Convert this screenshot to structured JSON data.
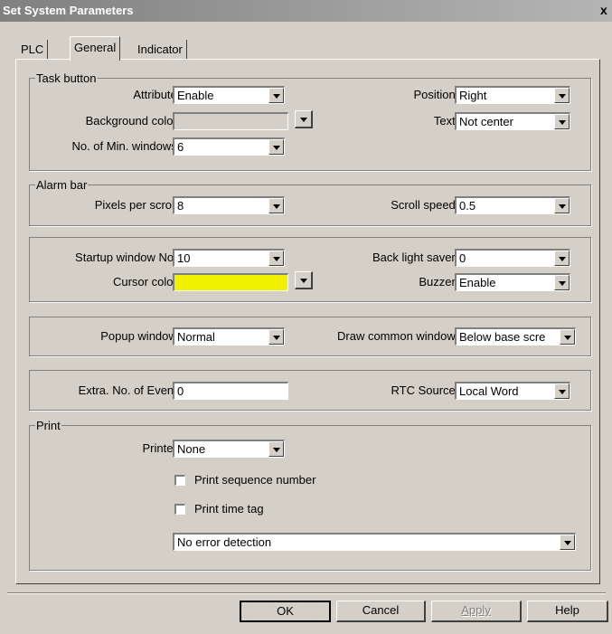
{
  "window": {
    "title": "Set System Parameters",
    "close_glyph": "x"
  },
  "tabs": [
    {
      "label": "PLC",
      "active": false
    },
    {
      "label": "General",
      "active": true
    },
    {
      "label": "Indicator",
      "active": false
    }
  ],
  "task_button": {
    "legend": "Task button",
    "attribute_label": "Attribute :",
    "attribute_value": "Enable",
    "position_label": "Position :",
    "position_value": "Right",
    "bg_color_label": "Background color :",
    "text_label": "Text :",
    "text_value": "Not center",
    "min_windows_label": "No. of Min. windows :",
    "min_windows_value": "6"
  },
  "alarm_bar": {
    "legend": "Alarm bar",
    "pixels_label": "Pixels per scroll :",
    "pixels_value": "8",
    "speed_label": "Scroll speed :",
    "speed_value": "0.5"
  },
  "startup": {
    "window_label": "Startup window No. :",
    "window_value": "10",
    "backlight_label": "Back light saver :",
    "backlight_value": "0",
    "cursor_label": "Cursor color :",
    "cursor_color": "#f0f000",
    "buzzer_label": "Buzzer :",
    "buzzer_value": "Enable"
  },
  "popup": {
    "popup_label": "Popup window :",
    "popup_value": "Normal",
    "draw_label": "Draw common window :",
    "draw_value": "Below base scre"
  },
  "event": {
    "extra_label": "Extra. No. of Event :",
    "extra_value": "0",
    "rtc_label": "RTC Source :",
    "rtc_value": "Local Word"
  },
  "print": {
    "legend": "Print",
    "printer_label": "Printer :",
    "printer_value": "None",
    "seq_label": "Print sequence number",
    "time_label": "Print time tag",
    "error_value": "No error detection"
  },
  "buttons": {
    "ok": "OK",
    "cancel": "Cancel",
    "apply": "Apply",
    "help": "Help"
  },
  "icons": {
    "dropdown": "chevron-down-icon",
    "checkbox": "checkbox-icon"
  }
}
